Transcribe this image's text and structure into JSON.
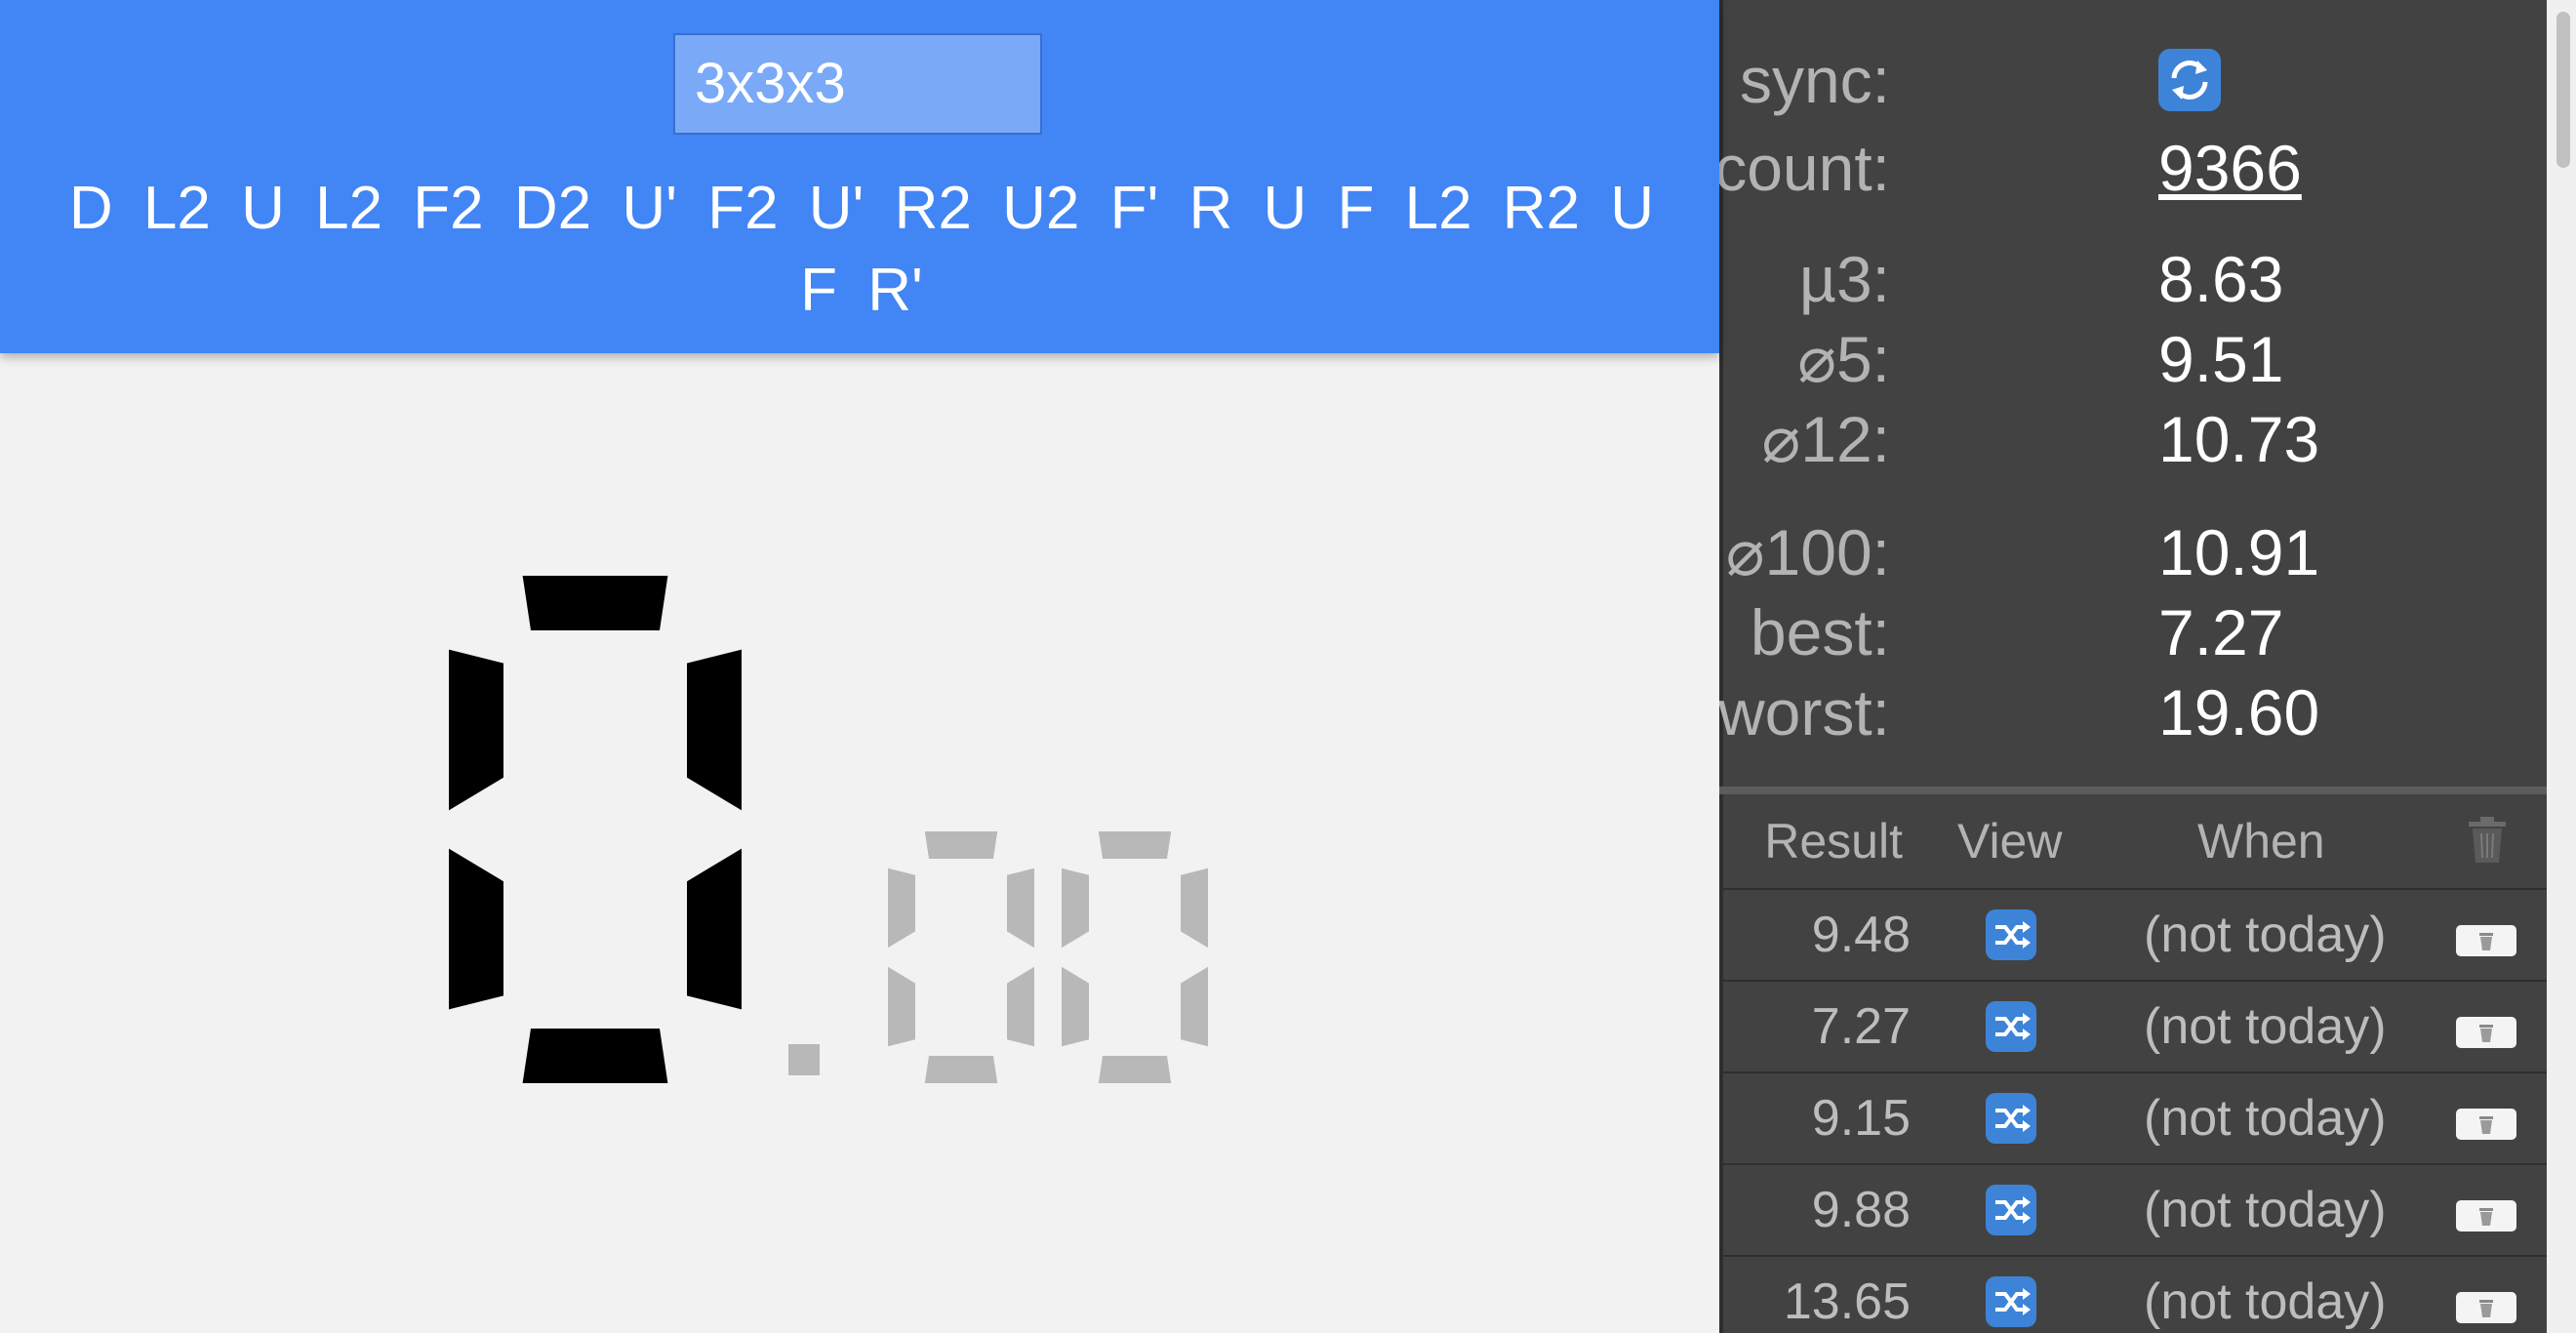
{
  "header": {
    "event": "3x3x3",
    "scramble": "D L2 U L2 F2 D2 U' F2 U' R2 U2 F' R U F L2 R2 U F R'"
  },
  "timer": {
    "display": "0.00",
    "digit_active_color": "#000000",
    "digit_dim_color": "#b8b8b8"
  },
  "stats": {
    "sync": {
      "label": "sync:",
      "icon": "sync-icon"
    },
    "count": {
      "label": "count:",
      "value": "9366"
    },
    "mean3": {
      "label": "µ3:",
      "value": "8.63"
    },
    "avg5": {
      "label": "⌀5:",
      "value": "9.51"
    },
    "avg12": {
      "label": "⌀12:",
      "value": "10.73"
    },
    "avg100": {
      "label": "⌀100:",
      "value": "10.91"
    },
    "best": {
      "label": "best:",
      "value": "7.27"
    },
    "worst": {
      "label": "worst:",
      "value": "19.60"
    }
  },
  "results": {
    "headers": {
      "result": "Result",
      "view": "View",
      "when": "When",
      "delete_icon": "trash-icon"
    },
    "rows": [
      {
        "result": "9.48",
        "when": "(not today)"
      },
      {
        "result": "7.27",
        "when": "(not today)"
      },
      {
        "result": "9.15",
        "when": "(not today)"
      },
      {
        "result": "9.88",
        "when": "(not today)"
      },
      {
        "result": "13.65",
        "when": "(not today)"
      }
    ]
  },
  "colors": {
    "header_blue": "#4285f4",
    "sidebar_bg": "#424242",
    "button_blue": "#3d84d8"
  }
}
